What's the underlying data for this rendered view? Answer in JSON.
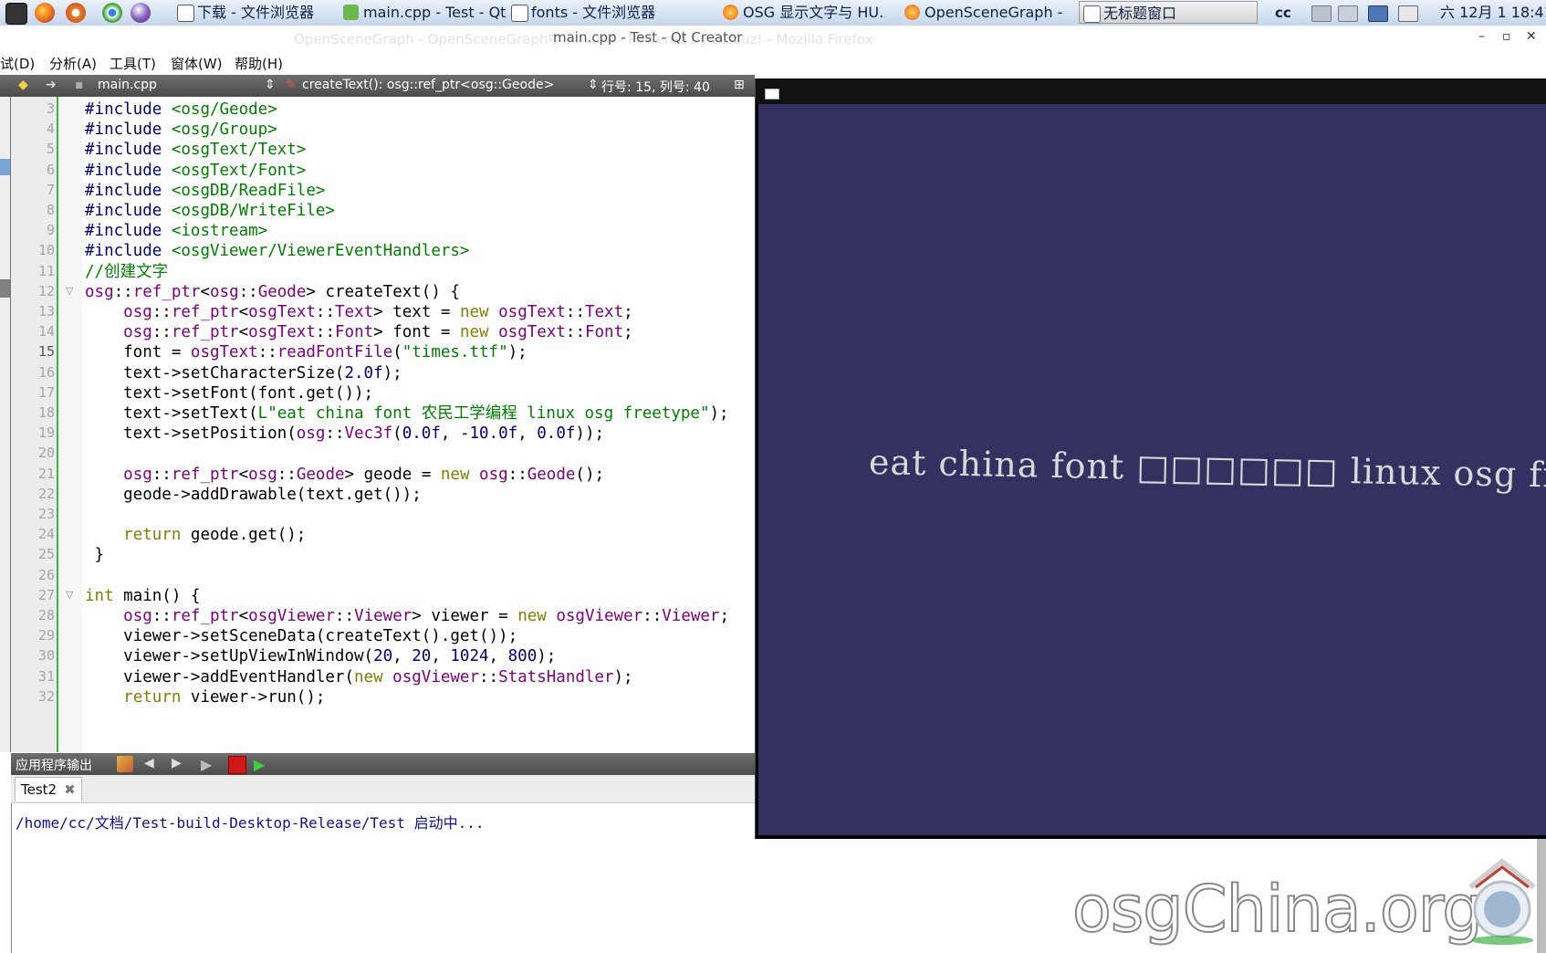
{
  "taskbar": {
    "tasks": [
      {
        "label": "下载 - 文件浏览器",
        "icon": "folder-icon"
      },
      {
        "label": "main.cpp - Test - Qt ...",
        "icon": "qt-creator-icon"
      },
      {
        "label": "fonts - 文件浏览器",
        "icon": "folder-icon"
      },
      {
        "label": "OSG 显示文字与 HU...",
        "icon": "firefox-icon"
      },
      {
        "label": "OpenSceneGraph - ...",
        "icon": "firefox-icon"
      },
      {
        "label": "无标题窗口",
        "icon": "window-icon"
      }
    ],
    "tray_user": "cc",
    "clock": "六 12月  1 18:41"
  },
  "window": {
    "ghost_title": "OpenSceneGraph - OpenSceneGraph中 ...                  ...mf - Powered by Discuz! - Mozilla Firefox",
    "title": "main.cpp - Test - Qt Creator",
    "minimize": "–",
    "maximize": "▫",
    "close": "✕"
  },
  "menu": [
    "试(D)",
    "分析(A)",
    "工具(T)",
    "窗体(W)",
    "帮助(H)"
  ],
  "editor_toolbar": {
    "file": "main.cpp",
    "function": "createText(): osg::ref_ptr<osg::Geode>",
    "position": "行号: 15, 列号: 40"
  },
  "editor": {
    "current_line": 15,
    "lines": [
      {
        "n": "3",
        "code": "#include <osg/Geode>"
      },
      {
        "n": "4",
        "code": "#include <osg/Group>"
      },
      {
        "n": "5",
        "code": "#include <osgText/Text>"
      },
      {
        "n": "6",
        "code": "#include <osgText/Font>"
      },
      {
        "n": "7",
        "code": "#include <osgDB/ReadFile>"
      },
      {
        "n": "8",
        "code": "#include <osgDB/WriteFile>"
      },
      {
        "n": "9",
        "code": "#include <iostream>"
      },
      {
        "n": "10",
        "code": "#include <osgViewer/ViewerEventHandlers>"
      },
      {
        "n": "11",
        "code": "//创建文字"
      },
      {
        "n": "12",
        "code": "osg::ref_ptr<osg::Geode> createText() {"
      },
      {
        "n": "13",
        "code": "    osg::ref_ptr<osgText::Text> text = new osgText::Text;"
      },
      {
        "n": "14",
        "code": "    osg::ref_ptr<osgText::Font> font = new osgText::Font;"
      },
      {
        "n": "15",
        "code": "    font = osgText::readFontFile(\"times.ttf\");"
      },
      {
        "n": "16",
        "code": "    text->setCharacterSize(2.0f);"
      },
      {
        "n": "17",
        "code": "    text->setFont(font.get());"
      },
      {
        "n": "18",
        "code": "    text->setText(L\"eat china font 农民工学编程 linux osg freetype\");"
      },
      {
        "n": "19",
        "code": "    text->setPosition(osg::Vec3f(0.0f, -10.0f, 0.0f));"
      },
      {
        "n": "20",
        "code": ""
      },
      {
        "n": "21",
        "code": "    osg::ref_ptr<osg::Geode> geode = new osg::Geode();"
      },
      {
        "n": "22",
        "code": "    geode->addDrawable(text.get());"
      },
      {
        "n": "23",
        "code": ""
      },
      {
        "n": "24",
        "code": "    return geode.get();"
      },
      {
        "n": "25",
        "code": " }"
      },
      {
        "n": "26",
        "code": ""
      },
      {
        "n": "27",
        "code": "int main() {"
      },
      {
        "n": "28",
        "code": "    osg::ref_ptr<osgViewer::Viewer> viewer = new osgViewer::Viewer;"
      },
      {
        "n": "29",
        "code": "    viewer->setSceneData(createText().get());"
      },
      {
        "n": "30",
        "code": "    viewer->setUpViewInWindow(20, 20, 1024, 800);"
      },
      {
        "n": "31",
        "code": "    viewer->addEventHandler(new osgViewer::StatsHandler);"
      },
      {
        "n": "32",
        "code": "    return viewer->run();"
      }
    ]
  },
  "output": {
    "title": "应用程序输出",
    "tab": "Test2",
    "line": "/home/cc/文档/Test-build-Desktop-Release/Test 启动中..."
  },
  "osg_window": {
    "rendered_text": "eat china font □□□□□□ linux osg freetyp"
  },
  "watermark": "osgChina.org"
}
